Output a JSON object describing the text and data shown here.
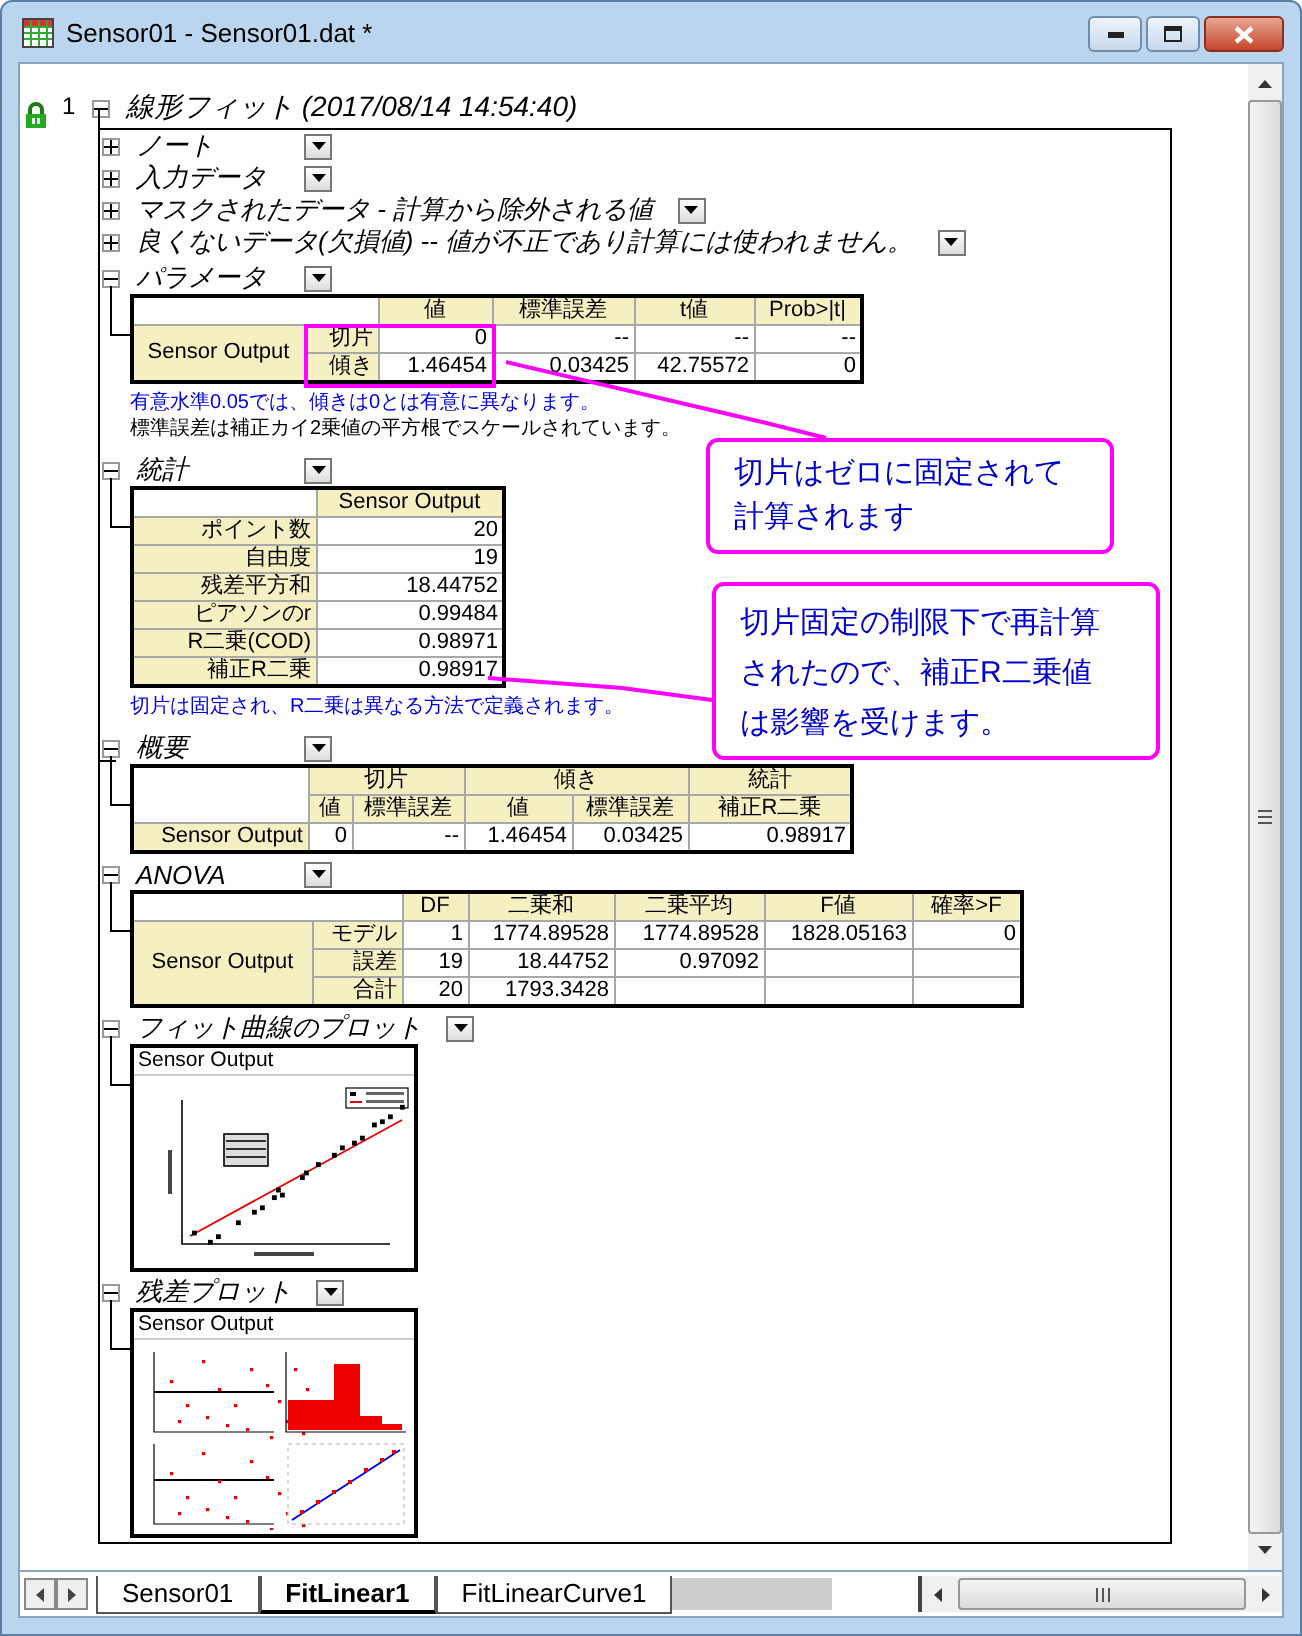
{
  "window": {
    "title": "Sensor01 - Sensor01.dat *"
  },
  "gutter": {
    "row_number": "1",
    "locked": true
  },
  "report": {
    "title": "線形フィット (2017/08/14 14:54:40)",
    "expanded": true,
    "sections": [
      {
        "title": "ノート",
        "expanded": false
      },
      {
        "title": "入力データ",
        "expanded": false
      },
      {
        "title": "マスクされたデータ - 計算から除外される値",
        "expanded": false
      },
      {
        "title": "良くないデータ(欠損値) -- 値が不正であり計算には使われません。",
        "expanded": false
      },
      {
        "kind": "parameters",
        "title": "パラメータ",
        "expanded": true,
        "table": {
          "group": "Sensor Output",
          "columns": [
            "値",
            "標準誤差",
            "t値",
            "Prob>|t|"
          ],
          "rows": [
            {
              "label": "切片",
              "values": [
                "0",
                "--",
                "--",
                "--"
              ]
            },
            {
              "label": "傾き",
              "values": [
                "1.46454",
                "0.03425",
                "42.75572",
                "0"
              ]
            }
          ]
        },
        "notes": [
          {
            "kind": "info",
            "text": "有意水準0.05では、傾きは0とは有意に異なります。"
          },
          {
            "kind": "plain",
            "text": "標準誤差は補正カイ2乗値の平方根でスケールされています。"
          }
        ]
      },
      {
        "kind": "statistics",
        "title": "統計",
        "expanded": true,
        "table": {
          "column": "Sensor Output",
          "rows": [
            {
              "label": "ポイント数",
              "value": "20"
            },
            {
              "label": "自由度",
              "value": "19"
            },
            {
              "label": "残差平方和",
              "value": "18.44752"
            },
            {
              "label": "ピアソンのr",
              "value": "0.99484"
            },
            {
              "label": "R二乗(COD)",
              "value": "0.98971"
            },
            {
              "label": "補正R二乗",
              "value": "0.98917"
            }
          ]
        },
        "notes": [
          {
            "kind": "info",
            "text": "切片は固定され、R二乗は異なる方法で定義されます。"
          }
        ]
      },
      {
        "kind": "summary",
        "title": "概要",
        "expanded": true,
        "table": {
          "groups": [
            {
              "label": "切片",
              "columns": [
                "値",
                "標準誤差"
              ]
            },
            {
              "label": "傾き",
              "columns": [
                "値",
                "標準誤差"
              ]
            },
            {
              "label": "統計",
              "columns": [
                "補正R二乗"
              ]
            }
          ],
          "rows": [
            {
              "label": "Sensor Output",
              "values": [
                "0",
                "--",
                "1.46454",
                "0.03425",
                "0.98917"
              ]
            }
          ]
        }
      },
      {
        "kind": "anova",
        "title": "ANOVA",
        "expanded": true,
        "table": {
          "group": "Sensor Output",
          "columns": [
            "DF",
            "二乗和",
            "二乗平均",
            "F値",
            "確率>F"
          ],
          "rows": [
            {
              "label": "モデル",
              "values": [
                "1",
                "1774.89528",
                "1774.89528",
                "1828.05163",
                "0"
              ]
            },
            {
              "label": "誤差",
              "values": [
                "19",
                "18.44752",
                "0.97092"
              ]
            },
            {
              "label": "合計",
              "values": [
                "20",
                "1793.3428"
              ]
            }
          ]
        }
      },
      {
        "kind": "fit_plot",
        "title": "フィット曲線のプロット",
        "expanded": true,
        "caption": "Sensor Output"
      },
      {
        "kind": "residual_plot",
        "title": "残差プロット",
        "expanded": true,
        "caption": "Sensor Output"
      }
    ]
  },
  "callouts": [
    {
      "text": "切片はゼロに固定されて計算されます"
    },
    {
      "text": "切片固定の制限下で再計算されたので、補正R二乗値は影響を受けます。"
    }
  ],
  "tabs": [
    {
      "label": "Sensor01",
      "selected": false
    },
    {
      "label": "FitLinear1",
      "selected": true
    },
    {
      "label": "FitLinearCurve1",
      "selected": false
    }
  ]
}
